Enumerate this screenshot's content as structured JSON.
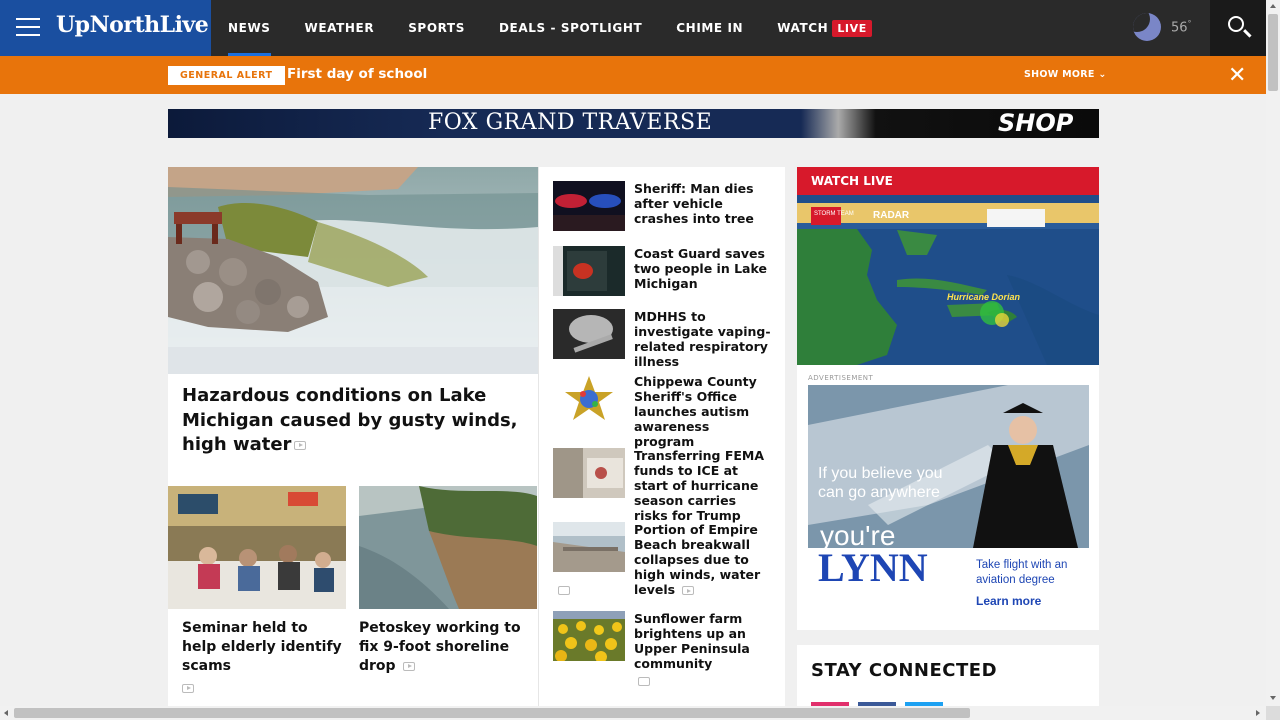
{
  "header": {
    "logo_text": "UpNorthLive",
    "nav": [
      {
        "label": "NEWS"
      },
      {
        "label": "WEATHER"
      },
      {
        "label": "SPORTS"
      },
      {
        "label": "DEALS - SPOTLIGHT"
      },
      {
        "label": "CHIME IN"
      },
      {
        "label": "WATCH"
      }
    ],
    "live_badge": "LIVE",
    "temperature": "56",
    "temperature_unit": "°",
    "icons": [
      "menu-icon",
      "moon-icon",
      "search-icon"
    ]
  },
  "alert": {
    "tag": "GENERAL ALERT",
    "text": "First day of school",
    "show_more": "SHOW MORE",
    "chevron": "⌄",
    "close_glyph": "✕",
    "color": "#e8740b"
  },
  "ad_banner": {
    "brand": "FOX GRAND TRAVERSE",
    "cta": "SHOP"
  },
  "hero": {
    "title": "Hazardous conditions on Lake Michigan caused by gusty winds, high water",
    "media_icon": "video-icon"
  },
  "sub_stories": [
    {
      "title": "Seminar held to help elderly identify scams",
      "media_icon": "video-icon"
    },
    {
      "title": "Petoskey working to fix 9-foot shoreline drop",
      "media_icon": "video-icon"
    }
  ],
  "headlines": [
    {
      "title": "Sheriff: Man dies after vehicle crashes into tree"
    },
    {
      "title": "Coast Guard saves two people in Lake Michigan"
    },
    {
      "title": "MDHHS to investigate vaping-related respiratory illness"
    },
    {
      "title": "Chippewa County Sheriff's Office launches autism awareness program"
    },
    {
      "title": "Transferring FEMA funds to ICE at start of hurricane season carries risks for Trump"
    },
    {
      "title": "Portion of Empire Beach breakwall collapses due to high winds, water levels",
      "media_icon": "video-icon",
      "extra_icon": "photo-icon"
    },
    {
      "title": "Sunflower farm brightens up an Upper Peninsula community",
      "media_icon": "photo-icon"
    }
  ],
  "watch_live": {
    "heading": "WATCH LIVE",
    "storm_team": "STORM TEAM",
    "radar_label": "RADAR",
    "storm_name": "Hurricane Dorian"
  },
  "side_ad": {
    "label": "ADVERTISEMENT",
    "headline": "If you believe you can go anywhere",
    "brand_prefix": "you're",
    "brand": "LYNN",
    "tagline": "Take flight with an aviation degree",
    "cta": "Learn more"
  },
  "stay_connected": {
    "title": "STAY CONNECTED",
    "socials": [
      {
        "name": "instagram",
        "color": "#e1306c"
      },
      {
        "name": "facebook",
        "color": "#3b5998"
      },
      {
        "name": "twitter",
        "color": "#1da1f2"
      }
    ]
  }
}
